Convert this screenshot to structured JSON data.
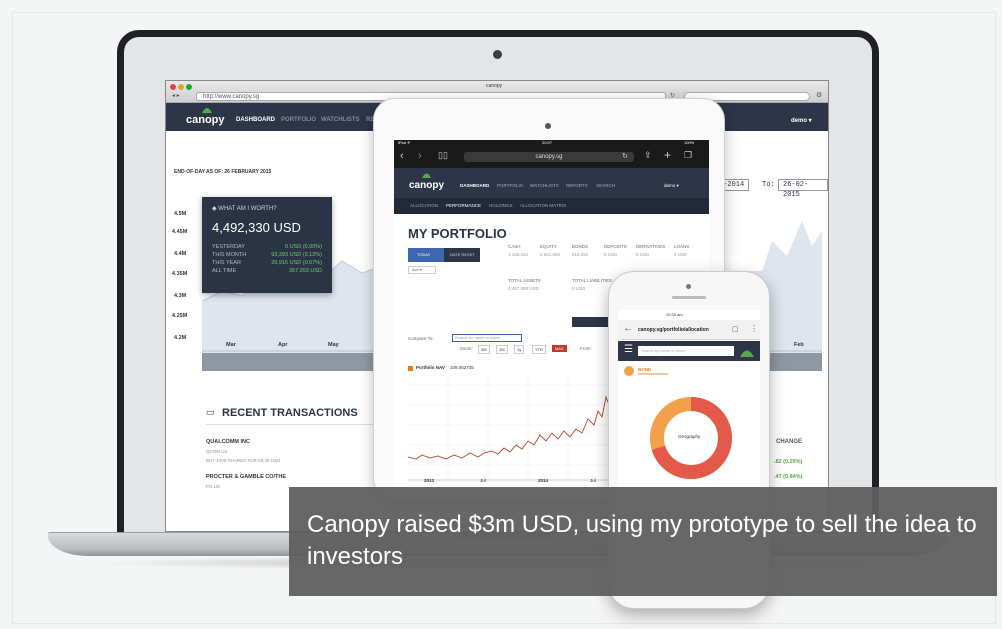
{
  "laptop": {
    "browser": {
      "title": "canopy",
      "url": "http://www.canopy.sg"
    },
    "nav": {
      "logo": "canopy",
      "items": [
        "DASHBOARD",
        "PORTFOLIO",
        "WATCHLISTS",
        "REP"
      ],
      "user": "demo ▾"
    },
    "end_of_day": "END-OF-DAY AS OF: 26 FEBRUARY 2015",
    "worth": {
      "heading": "WHAT AM I WORTH?",
      "total": "4,492,330 USD",
      "rows": [
        {
          "label": "YESTERDAY",
          "value": "0 USD  (0.00%)"
        },
        {
          "label": "THIS MONTH",
          "value": "93,393 USD  (2.12%)"
        },
        {
          "label": "THIS YEAR",
          "value": "29,915 USD  (0.67%)"
        },
        {
          "label": "ALL TIME",
          "value": "367,393 USD"
        }
      ]
    },
    "y_labels": [
      "4.5M",
      "4.45M",
      "4.4M",
      "4.35M",
      "4.3M",
      "4.25M",
      "4.2M"
    ],
    "x_labels": [
      "Mar",
      "Apr",
      "May",
      "Feb"
    ],
    "date_from": "2-2014",
    "date_to_label": "To:",
    "date_to": "26-02-2015",
    "recent": {
      "title": "RECENT TRANSACTIONS",
      "items": [
        {
          "name": "QUALCOMM INC",
          "ticker": "QCOM.US",
          "desc": "BUY 1000 SHARES FOR 65.45 USD"
        },
        {
          "name": "PROCTER & GAMBLE CO/THE",
          "ticker": "PG.US",
          "desc": ""
        }
      ]
    },
    "change_header": "CHANGE",
    "changes": [
      ".82 (0.29%)",
      ".47 (0.84%)"
    ]
  },
  "tablet": {
    "status": {
      "left": "iPad ✈",
      "center": "20:07",
      "right": "100%"
    },
    "url": "canopy.sg",
    "nav_items": [
      "DASHBOARD",
      "PORTFOLIO",
      "WATCHLISTS",
      "REPORTS",
      "SEARCH"
    ],
    "user": "demo ▾",
    "sub_items": [
      "ALLOCATION",
      "PERFORMANCE",
      "HOLDINGS",
      "ALLOCATION MATRIX"
    ],
    "title": "MY PORTFOLIO",
    "tabs": [
      "TODAY",
      "DATE RESET"
    ],
    "summary_headers": [
      "CASH",
      "EQUITY",
      "BONDS",
      "DEPOSITS",
      "DERIVATIVES",
      "LOANS"
    ],
    "summary_values": [
      "1,168,334",
      "2,561,663",
      "818,252",
      "0 USD",
      "0 USD",
      "0 USD"
    ],
    "total_assets_label": "TOTAL ASSETS",
    "total_assets": "4,467,958 USD",
    "total_liab_label": "TOTAL LIABILITIES",
    "total_liab": "0 USD",
    "compare_label": "Compare To:",
    "compare_placeholder": "Search for name or ticker",
    "zoom_label": "Zoom:",
    "zoom": [
      "3M",
      "1M",
      "1y",
      "YTD",
      "MAX"
    ],
    "from_label": "From:",
    "legend": "Portfolio NAV",
    "legend_value": "109.062745",
    "x_labels": [
      "2013",
      "Jul",
      "2014",
      "Jul"
    ]
  },
  "phone": {
    "status": "10:33 am",
    "url": "canopy.sg/portfolio/allocation",
    "search_placeholder": "Search by name or ticker",
    "item": "BOND",
    "center_label": "Geography"
  },
  "caption": "Canopy raised $3m USD, using my prototype to sell the idea to investors",
  "colors": {
    "nav": "#2c3648",
    "accent": "#5aa64b",
    "positive": "#6ccf6c",
    "donut_a": "#e45a4a",
    "donut_b": "#f2a04a"
  }
}
